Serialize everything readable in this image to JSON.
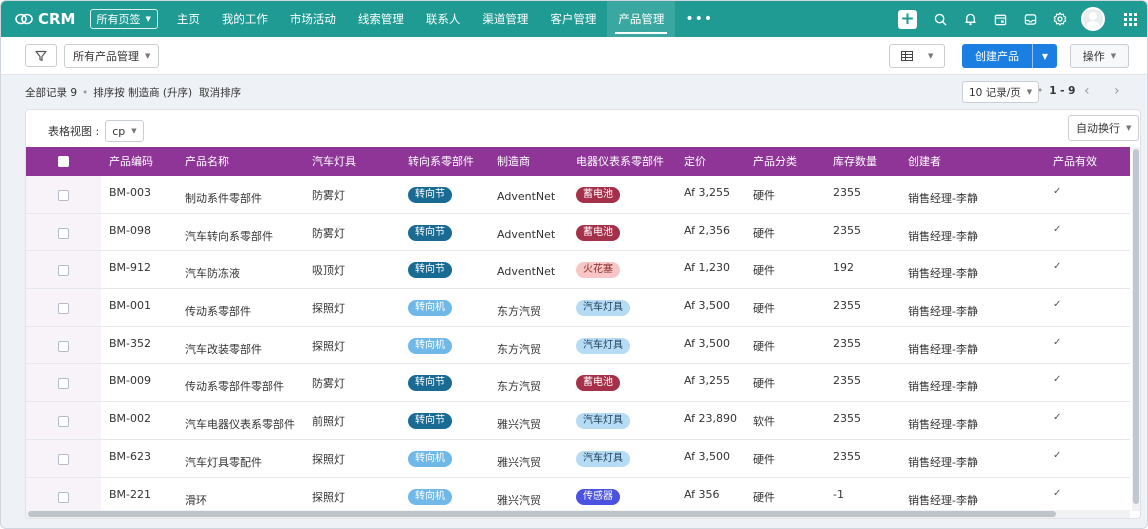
{
  "app": {
    "name": "CRM",
    "all_pages": "所有页签"
  },
  "nav": {
    "items": [
      "主页",
      "我的工作",
      "市场活动",
      "线索管理",
      "联系人",
      "渠道管理",
      "客户管理",
      "产品管理"
    ],
    "active": "产品管理",
    "more": "•••"
  },
  "toolbar": {
    "view_select": "所有产品管理",
    "create_label": "创建产品",
    "action_label": "操作"
  },
  "records": {
    "summary": "全部记录 9",
    "sort_text": "排序按 制造商 (升序)",
    "cancel_sort": "取消排序",
    "page_size": "10 记录/页",
    "page_range": "1 - 9"
  },
  "table_view": {
    "label": "表格视图 :",
    "value": "cp",
    "auto_wrap": "自动换行"
  },
  "columns": [
    "产品编码",
    "产品名称",
    "汽车灯具",
    "转向系零部件",
    "制造商",
    "电器仪表系零部件",
    "定价",
    "产品分类",
    "库存数量",
    "创建者",
    "产品有效"
  ],
  "tag_colors": {
    "转向节": {
      "bg": "#1a6b93",
      "fg": "#ffffff"
    },
    "转向机": {
      "bg": "#6fb8e8",
      "fg": "#ffffff"
    },
    "蓄电池": {
      "bg": "#a5304a",
      "fg": "#ffffff"
    },
    "火花塞": {
      "bg": "#f8c6c6",
      "fg": "#8a2e2e"
    },
    "汽车灯具": {
      "bg": "#b6dcf5",
      "fg": "#1d3c57"
    },
    "传感器": {
      "bg": "#4a52e0",
      "fg": "#ffffff"
    }
  },
  "rows": [
    {
      "code": "BM-003",
      "name": "制动系件零部件",
      "lamp": "防雾灯",
      "steering": "转向节",
      "maker": "AdventNet",
      "electric": "蓄电池",
      "price": "Af 3,255",
      "category": "硬件",
      "stock": "2355",
      "creator": "销售经理-李静",
      "valid": "✓"
    },
    {
      "code": "BM-098",
      "name": "汽车转向系零部件",
      "lamp": "防雾灯",
      "steering": "转向节",
      "maker": "AdventNet",
      "electric": "蓄电池",
      "price": "Af 2,356",
      "category": "硬件",
      "stock": "2355",
      "creator": "销售经理-李静",
      "valid": "✓"
    },
    {
      "code": "BM-912",
      "name": "汽车防冻液",
      "lamp": "吸顶灯",
      "steering": "转向节",
      "maker": "AdventNet",
      "electric": "火花塞",
      "price": "Af 1,230",
      "category": "硬件",
      "stock": "192",
      "creator": "销售经理-李静",
      "valid": "✓"
    },
    {
      "code": "BM-001",
      "name": "传动系零部件",
      "lamp": "探照灯",
      "steering": "转向机",
      "maker": "东方汽贸",
      "electric": "汽车灯具",
      "price": "Af 3,500",
      "category": "硬件",
      "stock": "2355",
      "creator": "销售经理-李静",
      "valid": "✓"
    },
    {
      "code": "BM-352",
      "name": "汽车改装零部件",
      "lamp": "探照灯",
      "steering": "转向机",
      "maker": "东方汽贸",
      "electric": "汽车灯具",
      "price": "Af 3,500",
      "category": "硬件",
      "stock": "2355",
      "creator": "销售经理-李静",
      "valid": "✓"
    },
    {
      "code": "BM-009",
      "name": "传动系零部件零部件",
      "lamp": "防雾灯",
      "steering": "转向节",
      "maker": "东方汽贸",
      "electric": "蓄电池",
      "price": "Af 3,255",
      "category": "硬件",
      "stock": "2355",
      "creator": "销售经理-李静",
      "valid": "✓"
    },
    {
      "code": "BM-002",
      "name": "汽车电器仪表系零部件",
      "lamp": "前照灯",
      "steering": "转向节",
      "maker": "雅兴汽贸",
      "electric": "汽车灯具",
      "price": "Af 23,890",
      "category": "软件",
      "stock": "2355",
      "creator": "销售经理-李静",
      "valid": "✓"
    },
    {
      "code": "BM-623",
      "name": "汽车灯具零配件",
      "lamp": "探照灯",
      "steering": "转向机",
      "maker": "雅兴汽贸",
      "electric": "汽车灯具",
      "price": "Af 3,500",
      "category": "硬件",
      "stock": "2355",
      "creator": "销售经理-李静",
      "valid": "✓"
    },
    {
      "code": "BM-221",
      "name": "滑环",
      "lamp": "探照灯",
      "steering": "转向机",
      "maker": "雅兴汽贸",
      "electric": "传感器",
      "price": "Af 356",
      "category": "硬件",
      "stock": "-1",
      "creator": "销售经理-李静",
      "valid": "✓"
    }
  ],
  "icons": [
    "crm-logo-icon",
    "plus-icon",
    "search-icon",
    "bell-icon",
    "calendar-icon",
    "inbox-icon",
    "settings-icon",
    "apps-grid-icon",
    "filter-icon",
    "table-view-icon",
    "chevron-left-icon",
    "chevron-right-icon"
  ]
}
